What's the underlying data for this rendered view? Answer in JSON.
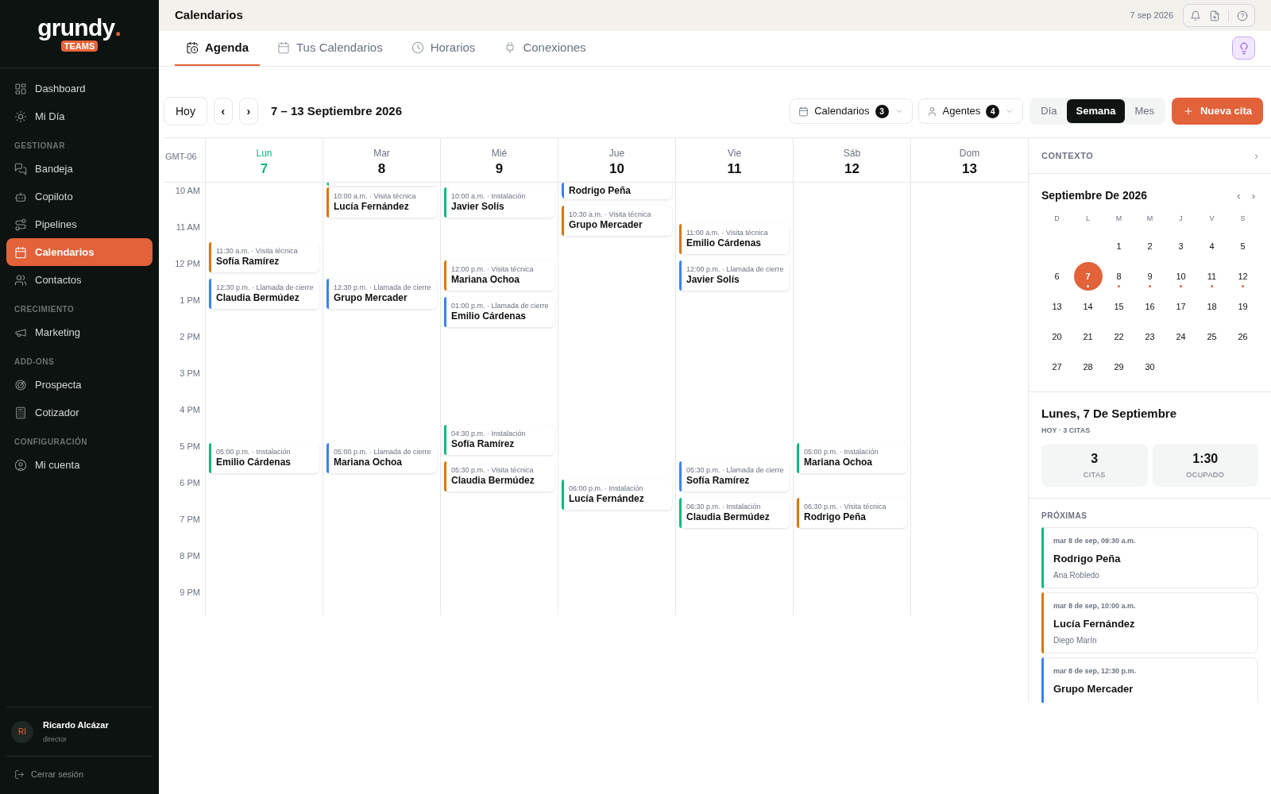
{
  "sidebar": {
    "logo": "grundy",
    "logo_dot": ".",
    "badge": "TEAMS",
    "nav": [
      {
        "kind": "item",
        "label": "Dashboard",
        "selected": false
      },
      {
        "kind": "item",
        "label": "Mi Día",
        "selected": false
      },
      {
        "kind": "heading",
        "label": "GESTIONAR"
      },
      {
        "kind": "item",
        "label": "Bandeja",
        "selected": false
      },
      {
        "kind": "item",
        "label": "Copiloto",
        "selected": false
      },
      {
        "kind": "item",
        "label": "Pipelines",
        "selected": false
      },
      {
        "kind": "item",
        "label": "Calendarios",
        "selected": true
      },
      {
        "kind": "item",
        "label": "Contactos",
        "selected": false
      },
      {
        "kind": "heading",
        "label": "CRECIMIENTO"
      },
      {
        "kind": "item",
        "label": "Marketing",
        "selected": false
      },
      {
        "kind": "heading",
        "label": "ADD-ONS"
      },
      {
        "kind": "item",
        "label": "Prospecta",
        "selected": false
      },
      {
        "kind": "item",
        "label": "Cotizador",
        "selected": false
      },
      {
        "kind": "heading",
        "label": "CONFIGURACIÓN"
      },
      {
        "kind": "item",
        "label": "Mi cuenta",
        "selected": false
      }
    ],
    "user": {
      "initials": "RI",
      "name": "Ricardo Alcázar",
      "role": "director"
    },
    "logout": "Cerrar sesión"
  },
  "header": {
    "title": "Calendarios",
    "date": "7 sep 2026"
  },
  "tabs": [
    {
      "label": "Agenda",
      "selected": true
    },
    {
      "label": "Tus Calendarios",
      "selected": false
    },
    {
      "label": "Horarios",
      "selected": false
    },
    {
      "label": "Conexiones",
      "selected": false
    }
  ],
  "toolbar": {
    "today": "Hoy",
    "prev": "‹",
    "next": "›",
    "range": "7 – 13 Septiembre 2026",
    "filters": [
      {
        "label": "Calendarios",
        "count": "3"
      },
      {
        "label": "Agentes",
        "count": "4"
      }
    ],
    "views": [
      {
        "label": "Día",
        "selected": false
      },
      {
        "label": "Semana",
        "selected": true
      },
      {
        "label": "Mes",
        "selected": false
      }
    ],
    "new_button": "Nueva cita"
  },
  "timezone": "GMT-06",
  "hours": [
    "10 AM",
    "11 AM",
    "12 PM",
    "1 PM",
    "2 PM",
    "3 PM",
    "4 PM",
    "5 PM",
    "6 PM",
    "7 PM",
    "8 PM",
    "9 PM"
  ],
  "days": [
    {
      "name": "Lun",
      "number": "7",
      "today": true,
      "events": [
        {
          "clipped": false,
          "detail": "11:30 a.m. · Visita técnica",
          "name": "Sofía Ramírez",
          "color": "#d97706"
        },
        {
          "clipped": false,
          "detail": "12:30 p.m. · Llamada de cierre",
          "name": "Claudia Bermúdez",
          "color": "#3b82f6"
        },
        {
          "clipped": false,
          "detail": "05:00 p.m. · Instalación",
          "name": "Emilio Cárdenas",
          "color": "#10b981"
        }
      ]
    },
    {
      "name": "Mar",
      "number": "8",
      "today": false,
      "events": [
        {
          "clipped": true,
          "color": "#10b981"
        },
        {
          "clipped": false,
          "detail": "10:00 a.m. · Visita técnica",
          "name": "Lucía Fernández",
          "color": "#d97706"
        },
        {
          "clipped": false,
          "detail": "12:30 p.m. · Llamada de cierre",
          "name": "Grupo Mercader",
          "color": "#3b82f6"
        },
        {
          "clipped": false,
          "detail": "05:00 p.m. · Llamada de cierre",
          "name": "Mariana Ochoa",
          "color": "#3b82f6"
        }
      ]
    },
    {
      "name": "Mié",
      "number": "9",
      "today": false,
      "events": [
        {
          "clipped": false,
          "detail": "10:00 a.m. · Instalación",
          "name": "Javier Solís",
          "color": "#10b981"
        },
        {
          "clipped": false,
          "detail": "12:00 p.m. · Visita técnica",
          "name": "Mariana Ochoa",
          "color": "#d97706"
        },
        {
          "clipped": false,
          "detail": "01:00 p.m. · Llamada de cierre",
          "name": "Emilio Cárdenas",
          "color": "#3b82f6"
        },
        {
          "clipped": false,
          "detail": "04:30 p.m. · Instalación",
          "name": "Sofía Ramírez",
          "color": "#10b981"
        },
        {
          "clipped": false,
          "detail": "05:30 p.m. · Visita técnica",
          "name": "Claudia Bermúdez",
          "color": "#d97706"
        }
      ]
    },
    {
      "name": "Jue",
      "number": "10",
      "today": false,
      "events": [
        {
          "clipped": true,
          "name": "Rodrigo Peña",
          "color": "#3b82f6"
        },
        {
          "clipped": false,
          "detail": "10:30 a.m. · Visita técnica",
          "name": "Grupo Mercader",
          "color": "#d97706"
        },
        {
          "clipped": false,
          "detail": "06:00 p.m. · Instalación",
          "name": "Lucía Fernández",
          "color": "#10b981"
        }
      ]
    },
    {
      "name": "Vie",
      "number": "11",
      "today": false,
      "events": [
        {
          "clipped": false,
          "detail": "11:00 a.m. · Visita técnica",
          "name": "Emilio Cárdenas",
          "color": "#d97706"
        },
        {
          "clipped": false,
          "detail": "12:00 p.m. · Llamada de cierre",
          "name": "Javier Solís",
          "color": "#3b82f6"
        },
        {
          "clipped": false,
          "detail": "05:30 p.m. · Llamada de cierre",
          "name": "Sofía Ramírez",
          "color": "#3b82f6"
        },
        {
          "clipped": false,
          "detail": "06:30 p.m. · Instalación",
          "name": "Claudia Bermúdez",
          "color": "#10b981"
        }
      ]
    },
    {
      "name": "Sáb",
      "number": "12",
      "today": false,
      "events": [
        {
          "clipped": false,
          "detail": "05:00 p.m. · Instalación",
          "name": "Mariana Ochoa",
          "color": "#10b981"
        },
        {
          "clipped": false,
          "detail": "06:30 p.m. · Visita técnica",
          "name": "Rodrigo Peña",
          "color": "#d97706"
        }
      ]
    },
    {
      "name": "Dom",
      "number": "13",
      "today": false
    }
  ],
  "context": {
    "title": "CONTEXTO",
    "chevron": "›",
    "mini_calendar": {
      "month": "Septiembre De 2026",
      "prev": "‹",
      "next": "›",
      "weekdays": [
        "D",
        "L",
        "M",
        "M",
        "J",
        "V",
        "S"
      ],
      "weeks": [
        [
          {
            "label": "1",
            "selected": false,
            "dot": false
          },
          {
            "label": "2",
            "selected": false,
            "dot": false
          },
          {
            "label": "3",
            "selected": false,
            "dot": false
          },
          {
            "label": "4",
            "selected": false,
            "dot": false
          },
          {
            "label": "5",
            "selected": false,
            "dot": false
          }
        ],
        [
          {
            "label": "6",
            "selected": false,
            "dot": false
          },
          {
            "label": "7",
            "selected": true,
            "dot": true
          },
          {
            "label": "8",
            "selected": false,
            "dot": true
          },
          {
            "label": "9",
            "selected": false,
            "dot": true
          },
          {
            "label": "10",
            "selected": false,
            "dot": true
          },
          {
            "label": "11",
            "selected": false,
            "dot": true
          },
          {
            "label": "12",
            "selected": false,
            "dot": true
          }
        ],
        [
          {
            "label": "13",
            "selected": false,
            "dot": false
          },
          {
            "label": "14",
            "selected": false,
            "dot": false
          },
          {
            "label": "15",
            "selected": false,
            "dot": false
          },
          {
            "label": "16",
            "selected": false,
            "dot": false
          },
          {
            "label": "17",
            "selected": false,
            "dot": false
          },
          {
            "label": "18",
            "selected": false,
            "dot": false
          },
          {
            "label": "19",
            "selected": false,
            "dot": false
          }
        ],
        [
          {
            "label": "20",
            "selected": false,
            "dot": false
          },
          {
            "label": "21",
            "selected": false,
            "dot": false
          },
          {
            "label": "22",
            "selected": false,
            "dot": false
          },
          {
            "label": "23",
            "selected": false,
            "dot": false
          },
          {
            "label": "24",
            "selected": false,
            "dot": false
          },
          {
            "label": "25",
            "selected": false,
            "dot": false
          },
          {
            "label": "26",
            "selected": false,
            "dot": false
          }
        ],
        [
          {
            "label": "27",
            "selected": false,
            "dot": false
          },
          {
            "label": "28",
            "selected": false,
            "dot": false
          },
          {
            "label": "29",
            "selected": false,
            "dot": false
          },
          {
            "label": "30",
            "selected": false,
            "dot": false
          }
        ]
      ]
    },
    "day_title": "Lunes, 7 De Septiembre",
    "day_subtitle": "HOY · 3 CITAS",
    "stats": [
      {
        "value": "3",
        "label": "CITAS"
      },
      {
        "value": "1:30",
        "label": "OCUPADO"
      }
    ],
    "upcoming_title": "PRÓXIMAS",
    "upcoming": [
      {
        "when": "mar 8 de sep, 09:30 a.m.",
        "name": "Rodrigo Peña",
        "agent": "Ana Robledo",
        "color": "#10b981"
      },
      {
        "when": "mar 8 de sep, 10:00 a.m.",
        "name": "Lucía Fernández",
        "agent": "Diego Marín",
        "color": "#d97706"
      },
      {
        "when": "mar 8 de sep, 12:30 p.m.",
        "name": "Grupo Mercader",
        "color": "#3b82f6"
      }
    ]
  }
}
